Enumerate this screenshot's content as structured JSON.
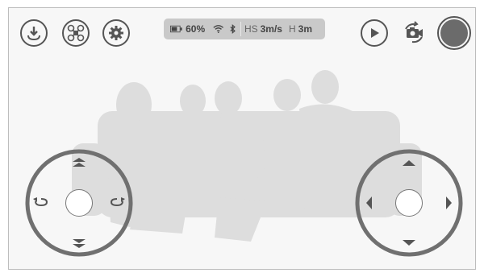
{
  "status": {
    "battery_text": "60%",
    "hs_label": "HS",
    "hs_value": "3m/s",
    "h_label": "H",
    "h_value": "3m"
  },
  "icons": {
    "left": [
      "takeoff-landing-icon",
      "drone-icon",
      "gear-icon"
    ],
    "right": [
      "play-icon",
      "camera-switch-icon",
      "record-icon"
    ],
    "status": [
      "battery-icon",
      "wifi-icon",
      "bluetooth-icon"
    ]
  },
  "colors": {
    "ui_dark": "#555555",
    "status_bg": "#c9c9c9",
    "record": "#6b6b6b",
    "silhouette": "#dddddd",
    "screen_bg": "#f7f7f7"
  }
}
